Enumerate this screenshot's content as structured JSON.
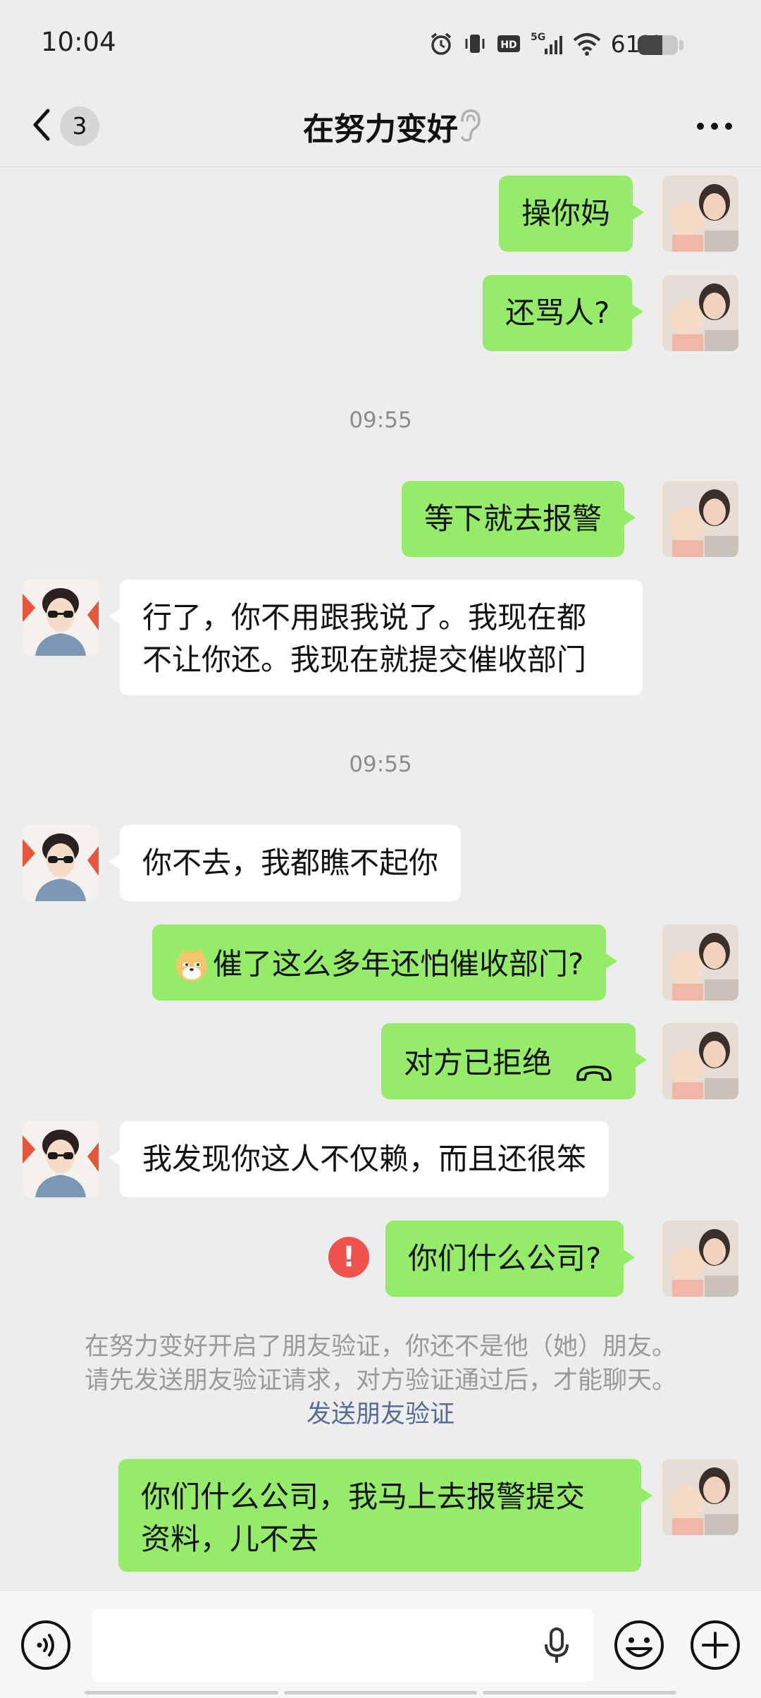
{
  "status_bar": {
    "time": "10:04",
    "battery_percent": "61%",
    "battery_level": 0.61,
    "network": "5G"
  },
  "header": {
    "back_badge": "3",
    "title": "在努力变好",
    "icons": [
      "back-icon",
      "ear-icon",
      "more-icon"
    ]
  },
  "messages": [
    {
      "from": "me",
      "text": "操你妈"
    },
    {
      "from": "me",
      "text": "还骂人?"
    },
    {
      "type": "time",
      "text": "09:55"
    },
    {
      "from": "me",
      "text": "等下就去报警"
    },
    {
      "from": "other",
      "line1": "行了，你不用跟我说了。我现在都",
      "line2": "不让你还。我现在就提交催收部门"
    },
    {
      "type": "time",
      "text": "09:55"
    },
    {
      "from": "other",
      "text": "你不去，我都瞧不起你"
    },
    {
      "from": "me",
      "text": "催了这么多年还怕催收部门?",
      "emoji": "doge"
    },
    {
      "from": "me",
      "text": "对方已拒绝",
      "icon": "hangup-icon"
    },
    {
      "from": "other",
      "text": "我发现你这人不仅赖，而且还很笨"
    },
    {
      "from": "me",
      "text": "你们什么公司?",
      "error": "!"
    },
    {
      "from": "me",
      "line1": "你们什么公司，我马上去报警提交",
      "line2": "资料，儿不去"
    }
  ],
  "system_notice": {
    "line1": "在努力变好开启了朋友验证，你还不是他（她）朋友。",
    "line2": "请先发送朋友验证请求，对方验证通过后，才能聊天。",
    "link": "发送朋友验证"
  },
  "input_bar": {
    "value": "",
    "icons": [
      "voice-icon",
      "mic-icon",
      "emoji-icon",
      "plus-icon"
    ]
  },
  "colors": {
    "background": "#ededed",
    "my_bubble": "#95ec69",
    "other_bubble": "#ffffff",
    "link": "#576b95",
    "error": "#f0524d"
  }
}
